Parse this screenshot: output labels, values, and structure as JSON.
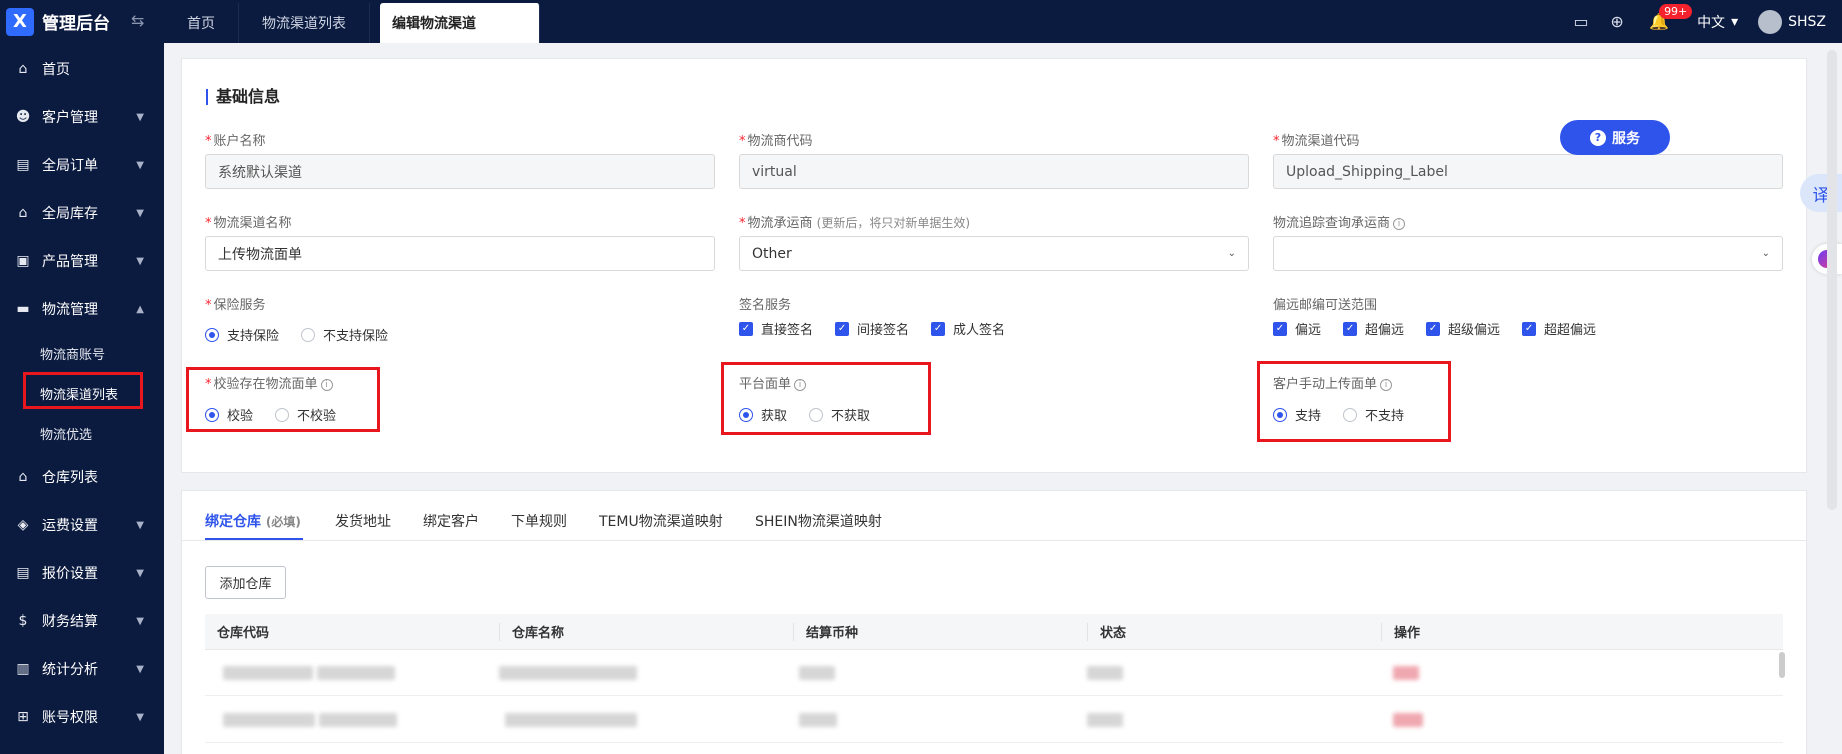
{
  "app": {
    "title": "管理后台",
    "logo_letter": "X"
  },
  "tabs": [
    {
      "label": "首页"
    },
    {
      "label": "物流渠道列表"
    },
    {
      "label": "编辑物流渠道"
    }
  ],
  "topbar": {
    "notification_count": "99+",
    "language": "中文",
    "user": "SHSZ"
  },
  "sidebar": {
    "items": [
      {
        "label": "首页",
        "icon": "home-icon"
      },
      {
        "label": "客户管理",
        "icon": "customers-icon"
      },
      {
        "label": "全局订单",
        "icon": "orders-icon"
      },
      {
        "label": "全局库存",
        "icon": "inventory-icon"
      },
      {
        "label": "产品管理",
        "icon": "product-icon"
      },
      {
        "label": "物流管理",
        "icon": "truck-icon"
      },
      {
        "label": "仓库列表",
        "icon": "warehouse-icon"
      },
      {
        "label": "运费设置",
        "icon": "freight-icon"
      },
      {
        "label": "报价设置",
        "icon": "quote-icon"
      },
      {
        "label": "财务结算",
        "icon": "finance-icon"
      },
      {
        "label": "统计分析",
        "icon": "stats-icon"
      },
      {
        "label": "账号权限",
        "icon": "permission-icon"
      }
    ],
    "logistics_sub": [
      {
        "label": "物流商账号"
      },
      {
        "label": "物流渠道列表"
      },
      {
        "label": "物流优选"
      }
    ]
  },
  "form": {
    "section_title": "基础信息",
    "account_name": {
      "label": "账户名称",
      "value": "系统默认渠道"
    },
    "carrier_code": {
      "label": "物流商代码",
      "value": "virtual"
    },
    "channel_code": {
      "label": "物流渠道代码",
      "value": "Upload_Shipping_Label"
    },
    "channel_name": {
      "label": "物流渠道名称",
      "value": "上传物流面单"
    },
    "carrier": {
      "label": "物流承运商",
      "hint": "(更新后，将只对新单据生效)",
      "value": "Other"
    },
    "tracking_carrier": {
      "label": "物流追踪查询承运商",
      "value": ""
    },
    "insurance": {
      "label": "保险服务",
      "options": [
        "支持保险",
        "不支持保险"
      ],
      "selected": 0
    },
    "signature": {
      "label": "签名服务",
      "options": [
        "直接签名",
        "间接签名",
        "成人签名"
      ]
    },
    "remote": {
      "label": "偏远邮编可送范围",
      "options": [
        "偏远",
        "超偏远",
        "超级偏远",
        "超超偏远"
      ]
    },
    "verify_label": {
      "label": "校验存在物流面单",
      "options": [
        "校验",
        "不校验"
      ],
      "selected": 0
    },
    "platform_label": {
      "label": "平台面单",
      "options": [
        "获取",
        "不获取"
      ],
      "selected": 0
    },
    "manual_upload": {
      "label": "客户手动上传面单",
      "options": [
        "支持",
        "不支持"
      ],
      "selected": 0
    }
  },
  "service_button": "服务",
  "translate_button": "译",
  "bottom_tabs": [
    {
      "label": "绑定仓库",
      "hint": "(必填)"
    },
    {
      "label": "发货地址"
    },
    {
      "label": "绑定客户"
    },
    {
      "label": "下单规则"
    },
    {
      "label": "TEMU物流渠道映射"
    },
    {
      "label": "SHEIN物流渠道映射"
    }
  ],
  "add_warehouse_button": "添加仓库",
  "table": {
    "columns": [
      "仓库代码",
      "仓库名称",
      "结算币种",
      "状态",
      "操作"
    ]
  },
  "colors": {
    "accent": "#2f54eb",
    "sidebar_bg": "#0b1a3f",
    "highlight": "#e8171e"
  }
}
